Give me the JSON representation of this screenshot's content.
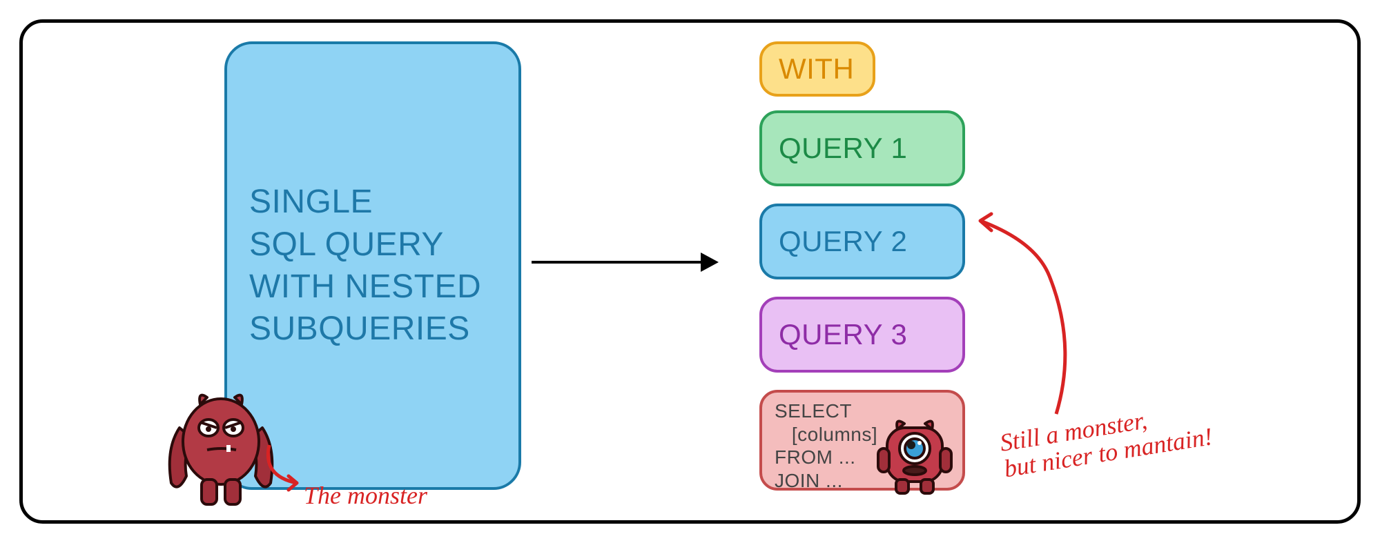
{
  "left_block": {
    "text": "SINGLE\nSQL QUERY\nWITH NESTED\nSUBQUERIES"
  },
  "right": {
    "with": "WITH",
    "q1": "QUERY 1",
    "q2": "QUERY 2",
    "q3": "QUERY 3",
    "select": "SELECT\n   [columns]\nFROM ...\nJOIN ..."
  },
  "annotations": {
    "monster": "The monster",
    "nicer": "Still a monster,\nbut nicer to mantain!"
  }
}
